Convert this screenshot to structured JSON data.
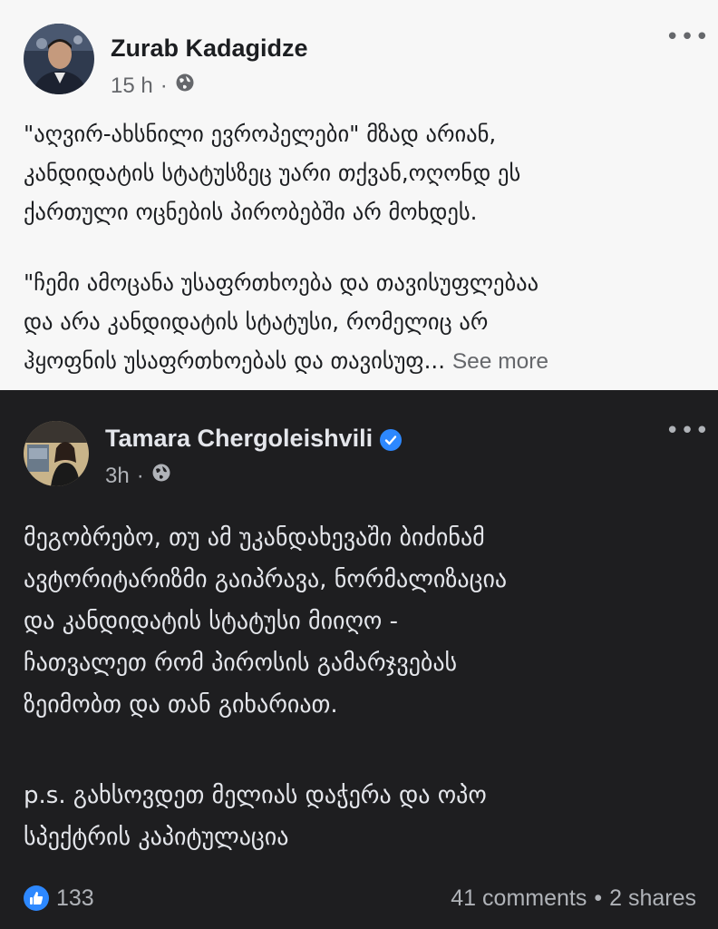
{
  "post1": {
    "author": "Zurab Kadagidze",
    "time": "15 h",
    "separator": "·",
    "globe_icon": "globe-icon",
    "more_icon": "more-icon",
    "text_lines": [
      "\"აღვირ-ახსნილი ევროპელები\" მზად არიან,",
      "კანდიდატის სტატუსზეც უარი თქვან,ოღონდ ეს",
      "ქართული ოცნების პირობებში არ მოხდეს."
    ],
    "quote_lines": [
      "\"ჩემი ამოცანა უსაფრთხოება და თავისუფლებაა",
      "და არა კანდიდატის სტატუსი, რომელიც არ"
    ],
    "quote_last": "ჰყოფნის უსაფრთხოებას და თავისუფ...",
    "see_more": "See more"
  },
  "post2": {
    "author": "Tamara Chergoleishvili",
    "time": "3h",
    "separator": "·",
    "verified_icon": "verified-badge-icon",
    "globe_icon": "globe-icon",
    "more_icon": "more-icon",
    "text_lines": [
      "მეგობრებო, თუ ამ უკანდახევაში ბიძინამ",
      "ავტორიტარიზმი გაიპრავა, ნორმალიზაცია",
      "და კანდიდატის სტატუსი მიიღო -",
      "ჩათვალეთ რომ პიროსის გამარჯვებას",
      "ზეიმობთ და თან გიხარიათ."
    ],
    "ps_lines": [
      "p.s. გახსოვდეთ მელიას დაჭერა და ოპო",
      "სპექტრის კაპიტულაცია"
    ],
    "likes_count": "133",
    "comments": "41 comments",
    "shares": "2 shares",
    "footer_separator": "•"
  },
  "colors": {
    "light_bg": "#f7f7f7",
    "dark_bg": "#1e1e20",
    "accent": "#2d88ff"
  }
}
